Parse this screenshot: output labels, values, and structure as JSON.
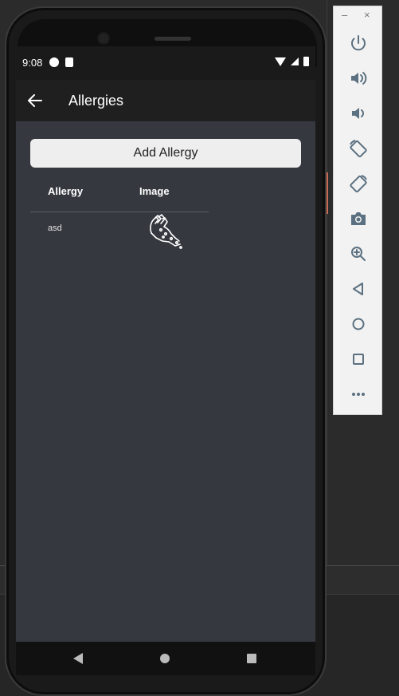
{
  "status": {
    "time": "9:08"
  },
  "appbar": {
    "title": "Allergies"
  },
  "add_button": {
    "label": "Add Allergy"
  },
  "table": {
    "columns": [
      "Allergy",
      "Image"
    ],
    "rows": [
      {
        "allergy": "asd",
        "image_icon": "skin-rash-hand-icon"
      }
    ]
  },
  "emulator_panel": {
    "minimize_label": "–",
    "close_label": "×",
    "tools": [
      "power-icon",
      "volume-up-icon",
      "volume-down-icon",
      "rotate-left-icon",
      "rotate-right-icon",
      "camera-icon",
      "zoom-icon",
      "back-icon",
      "home-icon",
      "overview-icon",
      "more-icon"
    ]
  },
  "colors": {
    "screen_bg": "#35393f",
    "appbar_bg": "#1f1f1f",
    "button_bg": "#eeeeee",
    "icon_color": "#5b7080"
  }
}
